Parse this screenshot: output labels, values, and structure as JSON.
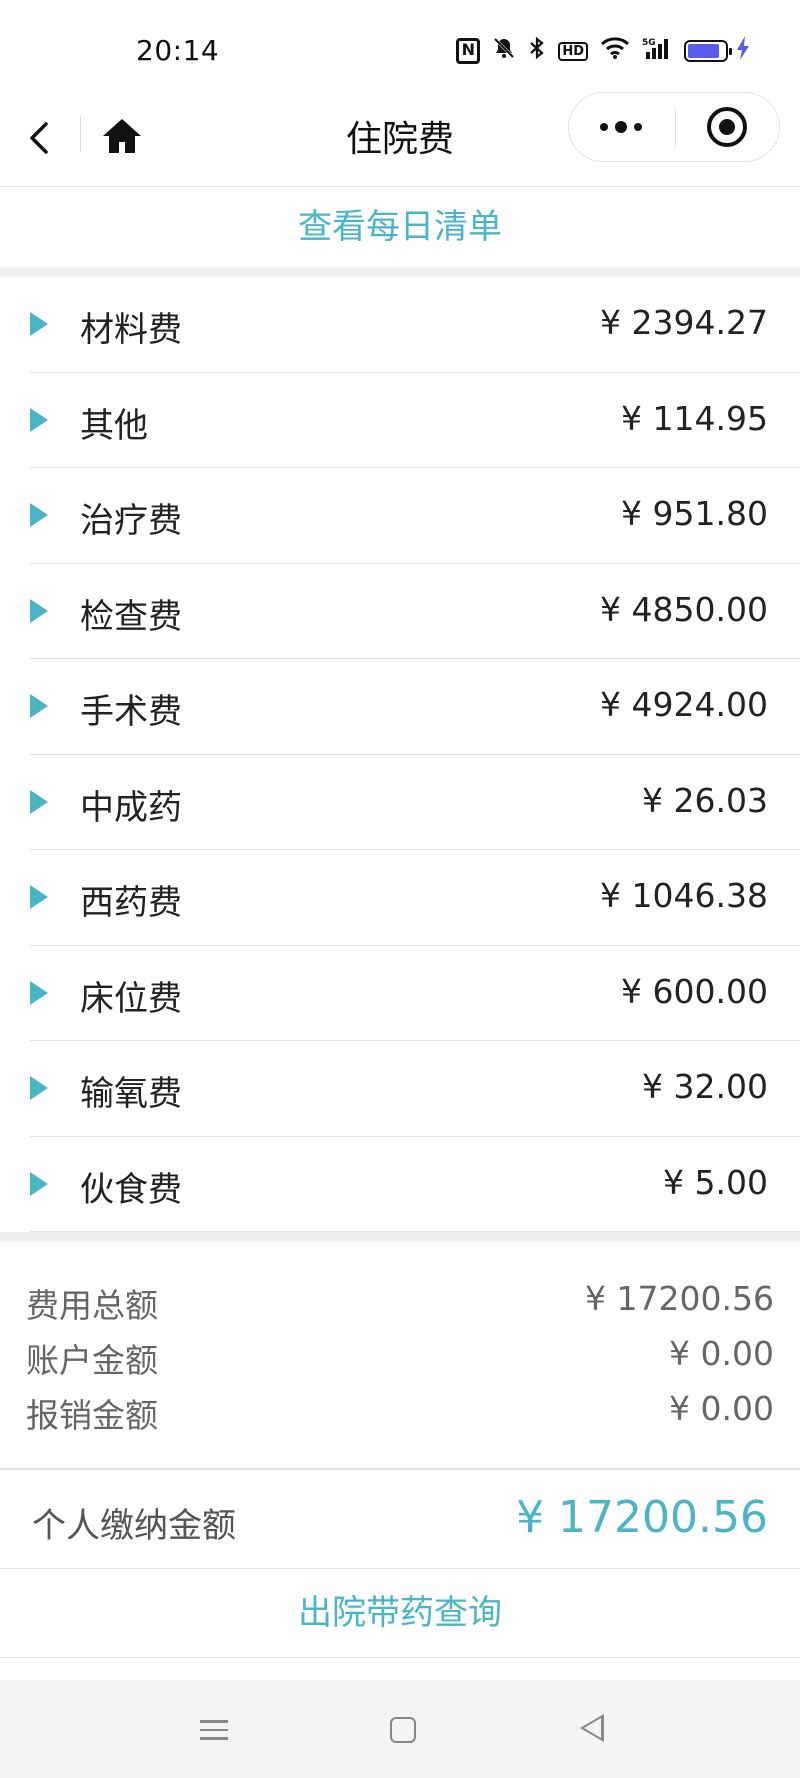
{
  "status_bar": {
    "time": "20:14",
    "icons": [
      "nfc-icon",
      "mute-icon",
      "bluetooth-icon",
      "hd-icon",
      "wifi-icon",
      "signal-5g-icon",
      "battery-icon",
      "charging-icon"
    ],
    "hd_label": "HD",
    "nfc_label": "N",
    "battery_level": 0.85
  },
  "nav": {
    "title": "住院费"
  },
  "daily_list_link": "查看每日清单",
  "fees": [
    {
      "name": "材料费",
      "amount": "¥ 2394.27"
    },
    {
      "name": "其他",
      "amount": "¥ 114.95"
    },
    {
      "name": "治疗费",
      "amount": "¥ 951.80"
    },
    {
      "name": "检查费",
      "amount": "¥ 4850.00"
    },
    {
      "name": "手术费",
      "amount": "¥ 4924.00"
    },
    {
      "name": "中成药",
      "amount": "¥ 26.03"
    },
    {
      "name": "西药费",
      "amount": "¥ 1046.38"
    },
    {
      "name": "床位费",
      "amount": "¥ 600.00"
    },
    {
      "name": "输氧费",
      "amount": "¥ 32.00"
    },
    {
      "name": "伙食费",
      "amount": "¥ 5.00"
    }
  ],
  "summary": {
    "total_label": "费用总额",
    "total_value": "¥ 17200.56",
    "account_label": "账户金额",
    "account_value": "¥ 0.00",
    "reimburse_label": "报销金额",
    "reimburse_value": "¥ 0.00"
  },
  "personal": {
    "label": "个人缴纳金额",
    "value": "¥ 17200.56"
  },
  "discharge_link": "出院带药查询",
  "colors": {
    "accent": "#4ab5c4",
    "battery": "#5b5bf0"
  }
}
